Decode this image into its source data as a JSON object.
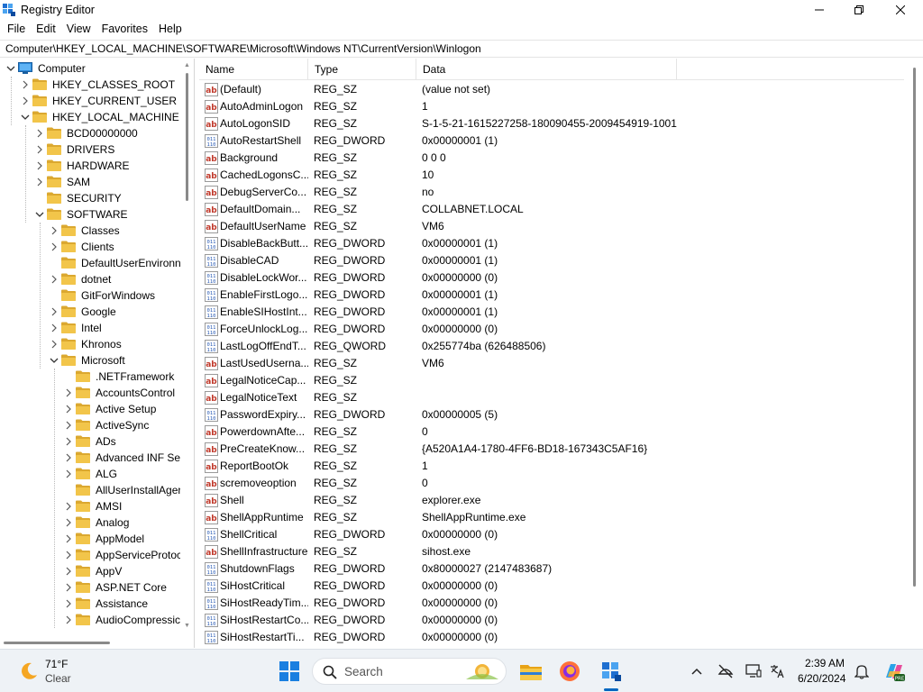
{
  "window": {
    "title": "Registry Editor",
    "controls": {
      "minimize": "minimize",
      "maximize": "maximize",
      "close": "close"
    }
  },
  "menu": [
    "File",
    "Edit",
    "View",
    "Favorites",
    "Help"
  ],
  "address": "Computer\\HKEY_LOCAL_MACHINE\\SOFTWARE\\Microsoft\\Windows NT\\CurrentVersion\\Winlogon",
  "tree": [
    {
      "label": "Computer",
      "level": 0,
      "state": "expanded",
      "icon": "computer-icon"
    },
    {
      "label": "HKEY_CLASSES_ROOT",
      "level": 1,
      "state": "collapsed"
    },
    {
      "label": "HKEY_CURRENT_USER",
      "level": 1,
      "state": "collapsed"
    },
    {
      "label": "HKEY_LOCAL_MACHINE",
      "level": 1,
      "state": "expanded"
    },
    {
      "label": "BCD00000000",
      "level": 2,
      "state": "collapsed"
    },
    {
      "label": "DRIVERS",
      "level": 2,
      "state": "collapsed"
    },
    {
      "label": "HARDWARE",
      "level": 2,
      "state": "collapsed"
    },
    {
      "label": "SAM",
      "level": 2,
      "state": "collapsed"
    },
    {
      "label": "SECURITY",
      "level": 2,
      "state": "none"
    },
    {
      "label": "SOFTWARE",
      "level": 2,
      "state": "expanded"
    },
    {
      "label": "Classes",
      "level": 3,
      "state": "collapsed"
    },
    {
      "label": "Clients",
      "level": 3,
      "state": "collapsed"
    },
    {
      "label": "DefaultUserEnvironn",
      "level": 3,
      "state": "none"
    },
    {
      "label": "dotnet",
      "level": 3,
      "state": "collapsed"
    },
    {
      "label": "GitForWindows",
      "level": 3,
      "state": "none"
    },
    {
      "label": "Google",
      "level": 3,
      "state": "collapsed"
    },
    {
      "label": "Intel",
      "level": 3,
      "state": "collapsed"
    },
    {
      "label": "Khronos",
      "level": 3,
      "state": "collapsed"
    },
    {
      "label": "Microsoft",
      "level": 3,
      "state": "expanded"
    },
    {
      "label": ".NETFramework",
      "level": 4,
      "state": "none"
    },
    {
      "label": "AccountsControl",
      "level": 4,
      "state": "collapsed"
    },
    {
      "label": "Active Setup",
      "level": 4,
      "state": "collapsed"
    },
    {
      "label": "ActiveSync",
      "level": 4,
      "state": "collapsed"
    },
    {
      "label": "ADs",
      "level": 4,
      "state": "collapsed"
    },
    {
      "label": "Advanced INF Set",
      "level": 4,
      "state": "collapsed"
    },
    {
      "label": "ALG",
      "level": 4,
      "state": "collapsed"
    },
    {
      "label": "AllUserInstallAger",
      "level": 4,
      "state": "none"
    },
    {
      "label": "AMSI",
      "level": 4,
      "state": "collapsed"
    },
    {
      "label": "Analog",
      "level": 4,
      "state": "collapsed"
    },
    {
      "label": "AppModel",
      "level": 4,
      "state": "collapsed"
    },
    {
      "label": "AppServiceProtoc",
      "level": 4,
      "state": "collapsed"
    },
    {
      "label": "AppV",
      "level": 4,
      "state": "collapsed"
    },
    {
      "label": "ASP.NET Core",
      "level": 4,
      "state": "collapsed"
    },
    {
      "label": "Assistance",
      "level": 4,
      "state": "collapsed"
    },
    {
      "label": "AudioCompressic",
      "level": 4,
      "state": "collapsed"
    }
  ],
  "columns": {
    "name": "Name",
    "type": "Type",
    "data": "Data"
  },
  "values": [
    {
      "name": "(Default)",
      "type": "REG_SZ",
      "data": "(value not set)"
    },
    {
      "name": "AutoAdminLogon",
      "type": "REG_SZ",
      "data": "1"
    },
    {
      "name": "AutoLogonSID",
      "type": "REG_SZ",
      "data": "S-1-5-21-1615227258-180090455-2009454919-1001"
    },
    {
      "name": "AutoRestartShell",
      "type": "REG_DWORD",
      "data": "0x00000001 (1)"
    },
    {
      "name": "Background",
      "type": "REG_SZ",
      "data": "0 0 0"
    },
    {
      "name": "CachedLogonsC...",
      "type": "REG_SZ",
      "data": "10"
    },
    {
      "name": "DebugServerCo...",
      "type": "REG_SZ",
      "data": "no"
    },
    {
      "name": "DefaultDomain...",
      "type": "REG_SZ",
      "data": "COLLABNET.LOCAL"
    },
    {
      "name": "DefaultUserName",
      "type": "REG_SZ",
      "data": "VM6"
    },
    {
      "name": "DisableBackButt...",
      "type": "REG_DWORD",
      "data": "0x00000001 (1)"
    },
    {
      "name": "DisableCAD",
      "type": "REG_DWORD",
      "data": "0x00000001 (1)"
    },
    {
      "name": "DisableLockWor...",
      "type": "REG_DWORD",
      "data": "0x00000000 (0)"
    },
    {
      "name": "EnableFirstLogo...",
      "type": "REG_DWORD",
      "data": "0x00000001 (1)"
    },
    {
      "name": "EnableSIHostInt...",
      "type": "REG_DWORD",
      "data": "0x00000001 (1)"
    },
    {
      "name": "ForceUnlockLog...",
      "type": "REG_DWORD",
      "data": "0x00000000 (0)"
    },
    {
      "name": "LastLogOffEndT...",
      "type": "REG_QWORD",
      "data": "0x255774ba (626488506)"
    },
    {
      "name": "LastUsedUserna...",
      "type": "REG_SZ",
      "data": "VM6"
    },
    {
      "name": "LegalNoticeCap...",
      "type": "REG_SZ",
      "data": ""
    },
    {
      "name": "LegalNoticeText",
      "type": "REG_SZ",
      "data": ""
    },
    {
      "name": "PasswordExpiry...",
      "type": "REG_DWORD",
      "data": "0x00000005 (5)"
    },
    {
      "name": "PowerdownAfte...",
      "type": "REG_SZ",
      "data": "0"
    },
    {
      "name": "PreCreateKnow...",
      "type": "REG_SZ",
      "data": "{A520A1A4-1780-4FF6-BD18-167343C5AF16}"
    },
    {
      "name": "ReportBootOk",
      "type": "REG_SZ",
      "data": "1"
    },
    {
      "name": "scremoveoption",
      "type": "REG_SZ",
      "data": "0"
    },
    {
      "name": "Shell",
      "type": "REG_SZ",
      "data": "explorer.exe"
    },
    {
      "name": "ShellAppRuntime",
      "type": "REG_SZ",
      "data": "ShellAppRuntime.exe"
    },
    {
      "name": "ShellCritical",
      "type": "REG_DWORD",
      "data": "0x00000000 (0)"
    },
    {
      "name": "ShellInfrastructure",
      "type": "REG_SZ",
      "data": "sihost.exe"
    },
    {
      "name": "ShutdownFlags",
      "type": "REG_DWORD",
      "data": "0x80000027 (2147483687)"
    },
    {
      "name": "SiHostCritical",
      "type": "REG_DWORD",
      "data": "0x00000000 (0)"
    },
    {
      "name": "SiHostReadyTim...",
      "type": "REG_DWORD",
      "data": "0x00000000 (0)"
    },
    {
      "name": "SiHostRestartCo...",
      "type": "REG_DWORD",
      "data": "0x00000000 (0)"
    },
    {
      "name": "SiHostRestartTi...",
      "type": "REG_DWORD",
      "data": "0x00000000 (0)"
    }
  ],
  "taskbar": {
    "weather": {
      "temp": "71°F",
      "condition": "Clear",
      "icon": "moon-icon"
    },
    "search_placeholder": "Search",
    "apps": [
      "start-icon",
      "file-explorer-icon",
      "firefox-icon",
      "registry-editor-icon"
    ],
    "tray": [
      "chevron-up-icon",
      "network-off-icon",
      "display-icon",
      "language-icon",
      "notification-bell-icon",
      "copilot-icon"
    ],
    "time": "2:39 AM",
    "date": "6/20/2024"
  },
  "colors": {
    "folder": "#f2c54a",
    "folder_dark": "#dba830",
    "accent": "#0067c0",
    "reg_sz_icon": "#c0392b",
    "reg_bin_icon": "#2a5bb5"
  }
}
